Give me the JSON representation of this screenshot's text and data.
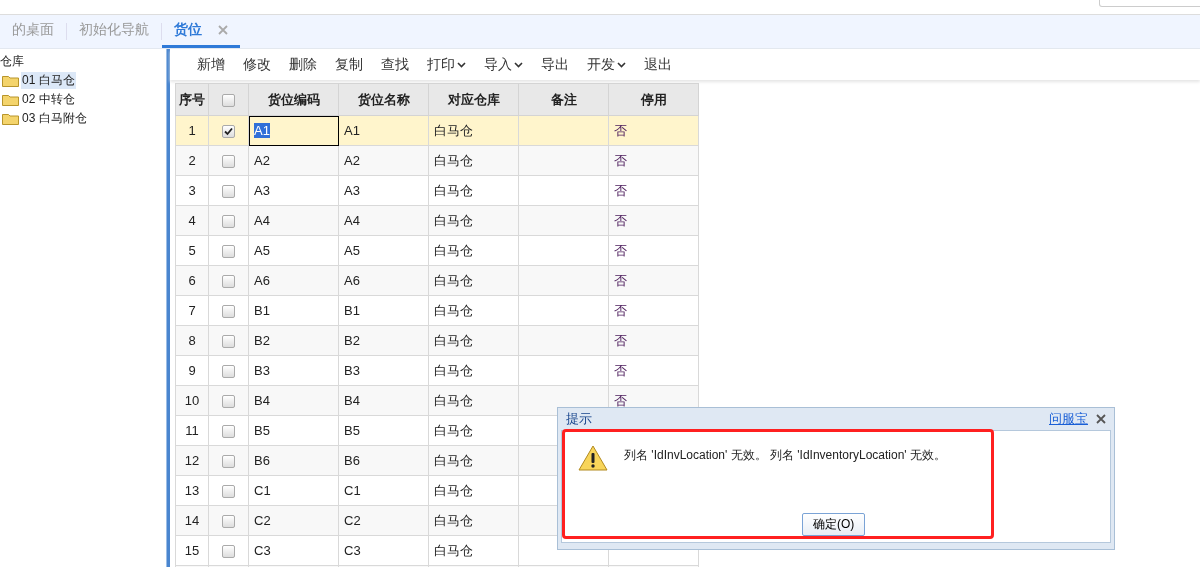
{
  "tabs": [
    {
      "label": "的桌面",
      "selected": false,
      "closable": false
    },
    {
      "label": "初始化导航",
      "selected": false,
      "closable": false
    },
    {
      "label": "货位",
      "selected": true,
      "closable": true
    }
  ],
  "tree": {
    "label": "仓库",
    "children": [
      {
        "label": "01 白马仓",
        "selected": true
      },
      {
        "label": "02 中转仓",
        "selected": false
      },
      {
        "label": "03 白马附仓",
        "selected": false
      }
    ]
  },
  "toolbar": [
    {
      "label": "新增",
      "dropdown": false
    },
    {
      "label": "修改",
      "dropdown": false
    },
    {
      "label": "删除",
      "dropdown": false
    },
    {
      "label": "复制",
      "dropdown": false
    },
    {
      "label": "查找",
      "dropdown": false
    },
    {
      "label": "打印",
      "dropdown": true
    },
    {
      "label": "导入",
      "dropdown": true
    },
    {
      "label": "导出",
      "dropdown": false
    },
    {
      "label": "开发",
      "dropdown": true
    },
    {
      "label": "退出",
      "dropdown": false
    }
  ],
  "table": {
    "all_checked": false,
    "columns": [
      "序号",
      "货位编码",
      "货位名称",
      "对应仓库",
      "备注",
      "停用"
    ],
    "rows": [
      {
        "index": "1",
        "checked": true,
        "selected": true,
        "code": "A1",
        "name": "A1",
        "warehouse": "白马仓",
        "disabled": "否"
      },
      {
        "index": "2",
        "checked": false,
        "selected": false,
        "code": "A2",
        "name": "A2",
        "warehouse": "白马仓",
        "disabled": "否"
      },
      {
        "index": "3",
        "checked": false,
        "selected": false,
        "code": "A3",
        "name": "A3",
        "warehouse": "白马仓",
        "disabled": "否"
      },
      {
        "index": "4",
        "checked": false,
        "selected": false,
        "code": "A4",
        "name": "A4",
        "warehouse": "白马仓",
        "disabled": "否"
      },
      {
        "index": "5",
        "checked": false,
        "selected": false,
        "code": "A5",
        "name": "A5",
        "warehouse": "白马仓",
        "disabled": "否"
      },
      {
        "index": "6",
        "checked": false,
        "selected": false,
        "code": "A6",
        "name": "A6",
        "warehouse": "白马仓",
        "disabled": "否"
      },
      {
        "index": "7",
        "checked": false,
        "selected": false,
        "code": "B1",
        "name": "B1",
        "warehouse": "白马仓",
        "disabled": "否"
      },
      {
        "index": "8",
        "checked": false,
        "selected": false,
        "code": "B2",
        "name": "B2",
        "warehouse": "白马仓",
        "disabled": "否"
      },
      {
        "index": "9",
        "checked": false,
        "selected": false,
        "code": "B3",
        "name": "B3",
        "warehouse": "白马仓",
        "disabled": "否"
      },
      {
        "index": "10",
        "checked": false,
        "selected": false,
        "code": "B4",
        "name": "B4",
        "warehouse": "白马仓",
        "disabled": "否"
      },
      {
        "index": "11",
        "checked": false,
        "selected": false,
        "code": "B5",
        "name": "B5",
        "warehouse": "白马仓"
      },
      {
        "index": "12",
        "checked": false,
        "selected": false,
        "code": "B6",
        "name": "B6",
        "warehouse": "白马仓"
      },
      {
        "index": "13",
        "checked": false,
        "selected": false,
        "code": "C1",
        "name": "C1",
        "warehouse": "白马仓"
      },
      {
        "index": "14",
        "checked": false,
        "selected": false,
        "code": "C2",
        "name": "C2",
        "warehouse": "白马仓"
      },
      {
        "index": "15",
        "checked": false,
        "selected": false,
        "code": "C3",
        "name": "C3",
        "warehouse": "白马仓"
      }
    ]
  },
  "dialog": {
    "title": "提示",
    "link": "问服宝",
    "message": "列名 'IdInvLocation' 无效。 列名 'IdInventoryLocation' 无效。",
    "ok_label": "确定(O)",
    "highlighted": true
  }
}
